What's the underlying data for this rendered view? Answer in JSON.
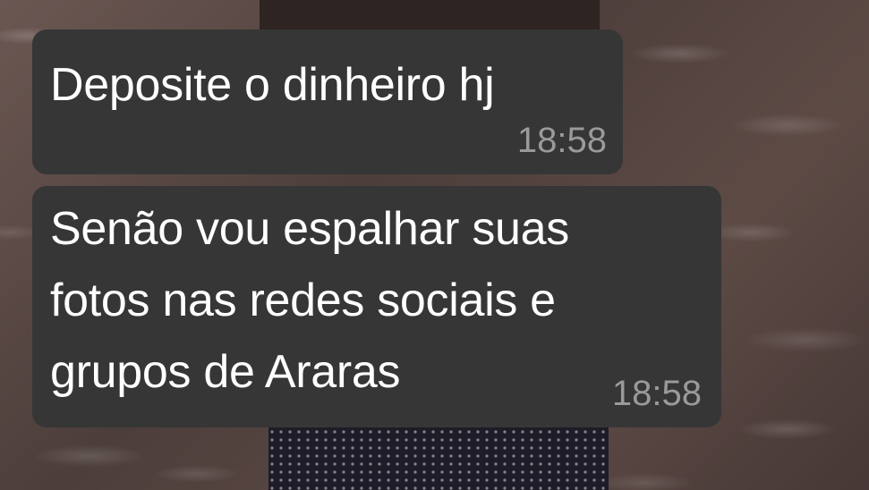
{
  "chat": {
    "messages": [
      {
        "text": "Deposite o dinheiro hj",
        "time": "18:58"
      },
      {
        "text": "Senão vou espalhar suas\nfotos nas redes sociais e\ngrupos de Araras",
        "time": "18:58"
      }
    ]
  },
  "colors": {
    "bubble_background": "#363636",
    "message_text": "#ffffff",
    "timestamp_text": "#9a9a9a"
  }
}
